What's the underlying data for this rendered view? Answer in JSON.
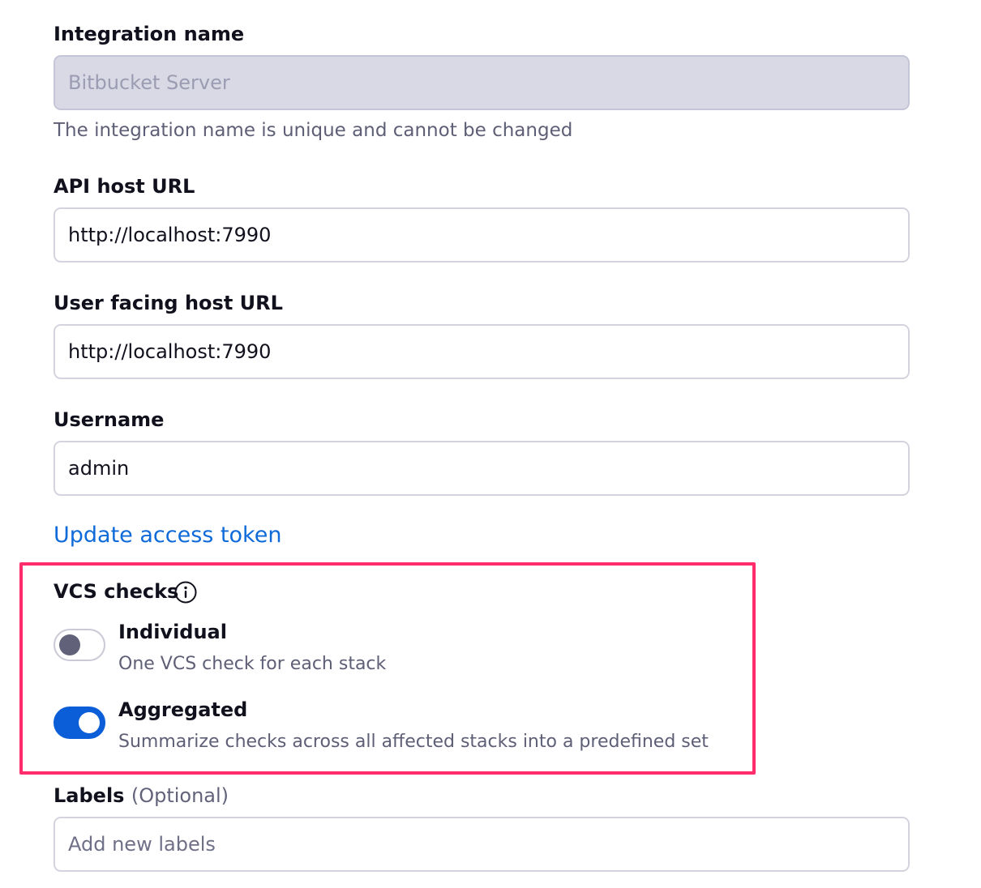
{
  "integration_name": {
    "label": "Integration name",
    "value": "Bitbucket Server",
    "help": "The integration name is unique and cannot be changed"
  },
  "api_host": {
    "label": "API host URL",
    "value": "http://localhost:7990"
  },
  "user_host": {
    "label": "User facing host URL",
    "value": "http://localhost:7990"
  },
  "username": {
    "label": "Username",
    "value": "admin"
  },
  "update_token": {
    "label": "Update access token"
  },
  "vcs_checks": {
    "label": "VCS checks",
    "info_icon": "info-icon",
    "options": [
      {
        "title": "Individual",
        "description": "One VCS check for each stack",
        "enabled": false
      },
      {
        "title": "Aggregated",
        "description": "Summarize checks across all affected stacks into a predefined set",
        "enabled": true
      }
    ]
  },
  "labels": {
    "label": "Labels",
    "optional": "(Optional)",
    "placeholder": "Add new labels"
  },
  "colors": {
    "accent": "#0b5ed7",
    "link": "#0f6ad9",
    "highlight_border": "#ff2c6c",
    "disabled_bg": "#d9d9e6"
  }
}
